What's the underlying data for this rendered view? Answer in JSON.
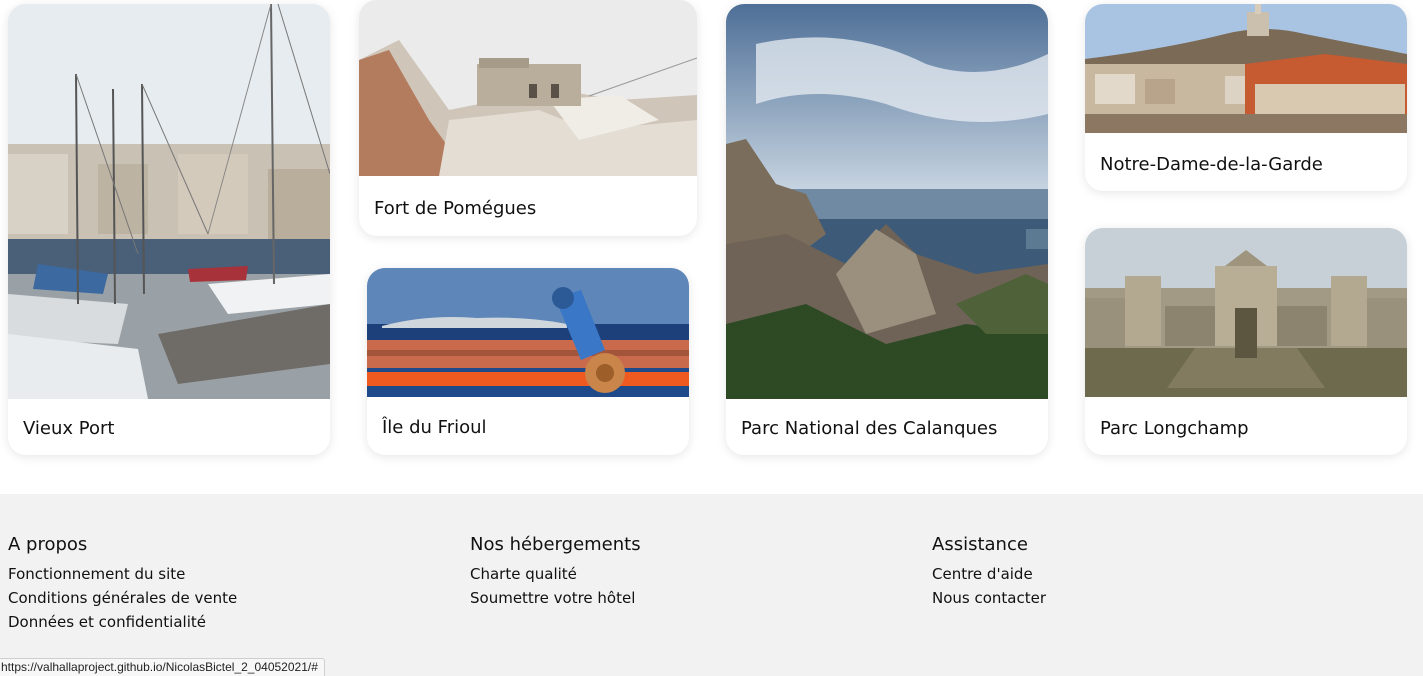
{
  "cards": [
    {
      "label": "Vieux Port",
      "image": "harbor-sailboats-photo"
    },
    {
      "label": "Fort de Pomégues",
      "image": "fort-on-rocks-photo"
    },
    {
      "label": "Île du Frioul",
      "image": "island-telescope-photo"
    },
    {
      "label": "Parc National des Calanques",
      "image": "calanques-cliffs-photo"
    },
    {
      "label": "Notre-Dame-de-la-Garde",
      "image": "basilica-hill-city-photo"
    },
    {
      "label": "Parc Longchamp",
      "image": "palais-longchamp-photo"
    }
  ],
  "footer": {
    "columns": [
      {
        "title": "A propos",
        "links": [
          "Fonctionnement du site",
          "Conditions générales de vente",
          "Données et confidentialité"
        ]
      },
      {
        "title": "Nos hébergements",
        "links": [
          "Charte qualité",
          "Soumettre votre hôtel"
        ]
      },
      {
        "title": "Assistance",
        "links": [
          "Centre d'aide",
          "Nous contacter"
        ]
      }
    ]
  },
  "status_url": "https://valhallaproject.github.io/NicolasBictel_2_04052021/#"
}
